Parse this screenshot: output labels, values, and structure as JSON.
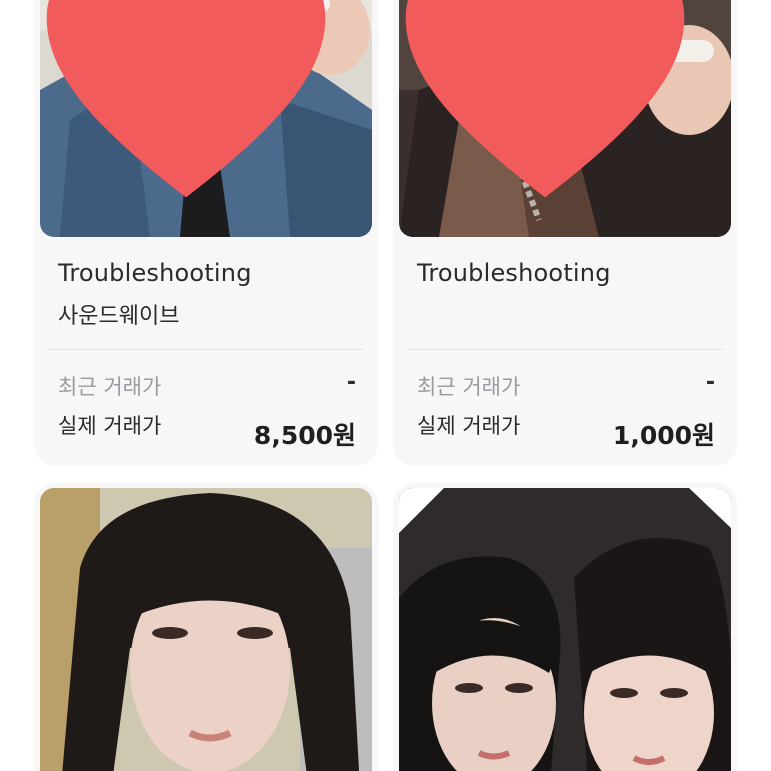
{
  "listings": [
    {
      "title": "Troubleshooting",
      "subtitle": "사운드웨이브",
      "recent_price_label": "최근 거래가",
      "recent_price": "-",
      "actual_price_label": "실제 거래가",
      "actual_price": "8,500원",
      "liked": true
    },
    {
      "title": "Troubleshooting",
      "subtitle": "",
      "recent_price_label": "최근 거래가",
      "recent_price": "-",
      "actual_price_label": "실제 거래가",
      "actual_price": "1,000원",
      "liked": true
    },
    {
      "liked": false
    },
    {
      "liked": false
    }
  ],
  "colors": {
    "heart": "#f25b5b",
    "card_bg": "#f7f7f8",
    "muted_text": "#9a9aa0"
  }
}
